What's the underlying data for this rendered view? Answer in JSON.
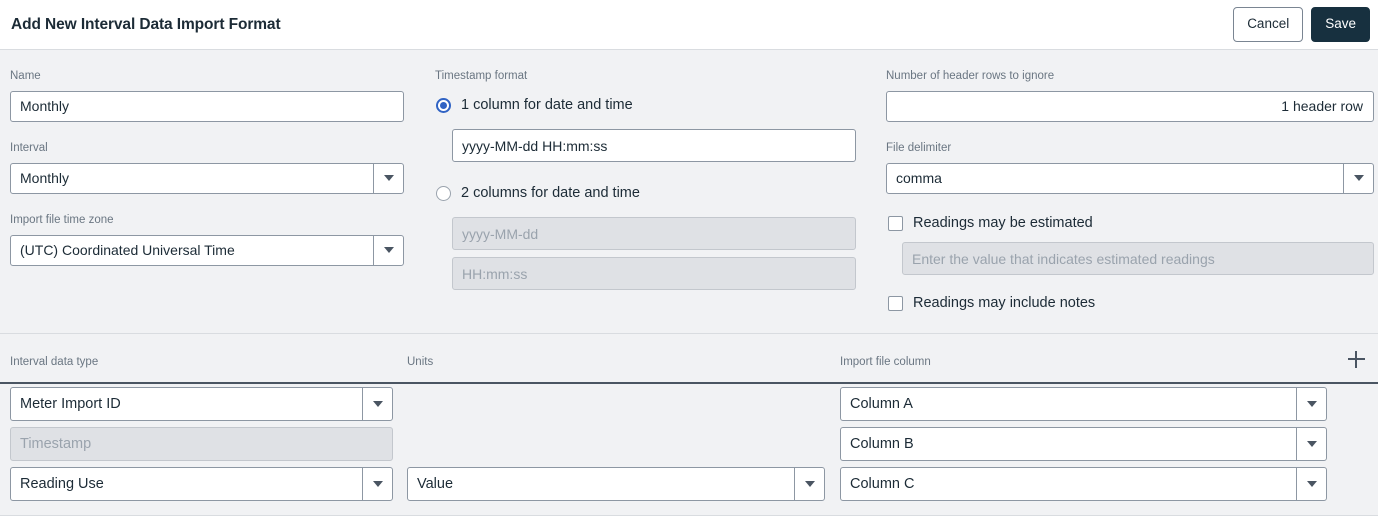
{
  "header": {
    "title": "Add New Interval Data Import Format",
    "cancel_label": "Cancel",
    "save_label": "Save"
  },
  "colors": {
    "save_bg": "#17303f",
    "radio_accent": "#3063c4",
    "page_bg": "#f1f2f4",
    "field_border": "#8d97a3",
    "disabled_bg": "#dfe1e5",
    "label_text": "#6a7682"
  },
  "form": {
    "name": {
      "label": "Name",
      "value": "Monthly"
    },
    "interval": {
      "label": "Interval",
      "value": "Monthly"
    },
    "time_zone": {
      "label": "Import file time zone",
      "value": "(UTC) Coordinated Universal Time"
    },
    "timestamp_format": {
      "label": "Timestamp format",
      "option_one": {
        "label": "1 column for date and time",
        "selected": true,
        "value": "yyyy-MM-dd HH:mm:ss"
      },
      "option_two": {
        "label": "2 columns for date and time",
        "selected": false,
        "date_placeholder": "yyyy-MM-dd",
        "time_placeholder": "HH:mm:ss"
      }
    },
    "header_rows": {
      "label": "Number of header rows to ignore",
      "value": "1 header row"
    },
    "file_delimiter": {
      "label": "File delimiter",
      "value": "comma"
    },
    "estimated": {
      "label": "Readings may be estimated",
      "checked": false,
      "placeholder": "Enter the value that indicates estimated readings"
    },
    "notes": {
      "label": "Readings may include notes",
      "checked": false
    }
  },
  "table": {
    "columns": [
      "Interval data type",
      "Units",
      "Import file column"
    ],
    "add_icon": "plus-icon",
    "rows": [
      {
        "data_type": "Meter Import ID",
        "data_type_disabled": false,
        "units": "",
        "units_shown": false,
        "import_column": "Column A"
      },
      {
        "data_type": "Timestamp",
        "data_type_disabled": true,
        "units": "",
        "units_shown": false,
        "import_column": "Column B"
      },
      {
        "data_type": "Reading Use",
        "data_type_disabled": false,
        "units": "Value",
        "units_shown": true,
        "import_column": "Column C"
      }
    ]
  }
}
